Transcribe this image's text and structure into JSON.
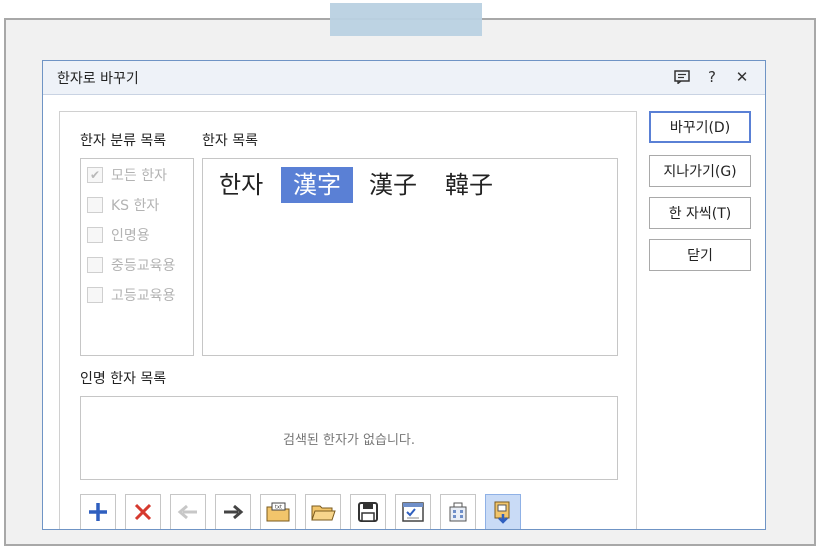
{
  "dialog": {
    "title": "한자로 바꾸기",
    "icons": [
      "comment-icon",
      "help-icon",
      "close-icon"
    ],
    "help_glyph": "?",
    "close_glyph": "✕"
  },
  "category": {
    "label": "한자 분류 목록",
    "items": [
      {
        "label": "모든 한자",
        "checked": true
      },
      {
        "label": "KS 한자",
        "checked": false
      },
      {
        "label": "인명용",
        "checked": false
      },
      {
        "label": "중등교육용",
        "checked": false
      },
      {
        "label": "고등교육용",
        "checked": false
      }
    ]
  },
  "hanja": {
    "label": "한자 목록",
    "items": [
      "한자",
      "漢字",
      "漢子",
      "韓子"
    ],
    "selected_index": 1
  },
  "name_hanja": {
    "label": "인명 한자 목록",
    "empty_text": "검색된 한자가 없습니다."
  },
  "buttons": {
    "replace": "바꾸기(D)",
    "skip": "지나가기(G)",
    "detail": "한 자씩(T)",
    "close": "닫기"
  },
  "toolbar": [
    "add-icon",
    "delete-icon",
    "arrow-left-icon",
    "arrow-right-icon",
    "folder-text-icon",
    "folder-open-icon",
    "save-icon",
    "checklist-icon",
    "building-icon",
    "export-icon"
  ],
  "colors": {
    "accent": "#5a80d5",
    "frame_border": "#6f94c5"
  }
}
